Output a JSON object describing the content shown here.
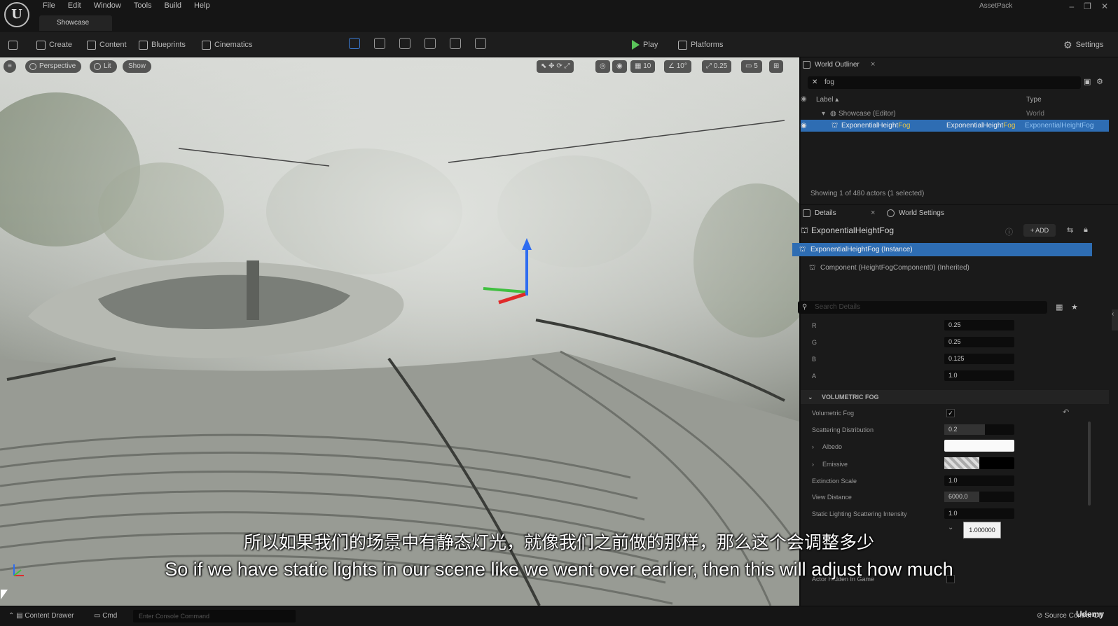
{
  "menu": [
    "File",
    "Edit",
    "Window",
    "Tools",
    "Build",
    "Help"
  ],
  "level_tab": "Showcase",
  "project_name": "AssetPack",
  "toolbar": {
    "create": "Create",
    "content": "Content",
    "blueprints": "Blueprints",
    "cinematics": "Cinematics",
    "play": "Play",
    "platforms": "Platforms",
    "settings": "Settings"
  },
  "viewport": {
    "perspective": "Perspective",
    "lit": "Lit",
    "show": "Show",
    "grid": "10",
    "angle": "10°",
    "scale": "0.25",
    "camera_speed": "5"
  },
  "subtitles": {
    "chinese": "所以如果我们的场景中有静态灯光，就像我们之前做的那样，那么这个会调整多少",
    "english": "So if we have static lights in our scene like we went over earlier, then this will adjust how much"
  },
  "outliner": {
    "tab": "World Outliner",
    "search": "fog",
    "col_label": "Label",
    "col_type": "Type",
    "rows": [
      {
        "label": "Showcase (Editor)",
        "type": "World"
      },
      {
        "label_prefix": "ExponentialHeight",
        "label_highlight": "Fog",
        "type_prefix": "ExponentialHeight",
        "type_highlight": "Fog",
        "type2": "ExponentialHeightFog"
      }
    ],
    "status": "Showing 1 of 480 actors (1 selected)"
  },
  "details": {
    "tab": "Details",
    "tab2": "World Settings",
    "actor_name": "ExponentialHeightFog",
    "add_label": "ADD",
    "instance_row": "ExponentialHeightFog (Instance)",
    "component_row": "Component (HeightFogComponent0) (Inherited)",
    "search_placeholder": "Search Details",
    "color_props": [
      {
        "name": "R",
        "value": "0.25"
      },
      {
        "name": "G",
        "value": "0.25"
      },
      {
        "name": "B",
        "value": "0.125"
      },
      {
        "name": "A",
        "value": "1.0"
      }
    ],
    "section": "VOLUMETRIC FOG",
    "props": {
      "volumetric_fog": "Volumetric Fog",
      "scattering_distribution": "Scattering Distribution",
      "scattering_value": "0.2",
      "albedo": "Albedo",
      "emissive": "Emissive",
      "extinction_scale": "Extinction Scale",
      "extinction_value": "1.0",
      "view_distance": "View Distance",
      "view_distance_value": "6000.0",
      "static_lighting": "Static Lighting Scattering Intensity",
      "static_lighting_value": "1.0",
      "popup_value": "1.000000",
      "actor_hidden": "Actor Hidden In Game"
    }
  },
  "bottombar": {
    "content_drawer": "Content Drawer",
    "cmd": "Cmd",
    "cmd_placeholder": "Enter Console Command",
    "source_control": "Source Control Off",
    "brand": "Udemy"
  }
}
